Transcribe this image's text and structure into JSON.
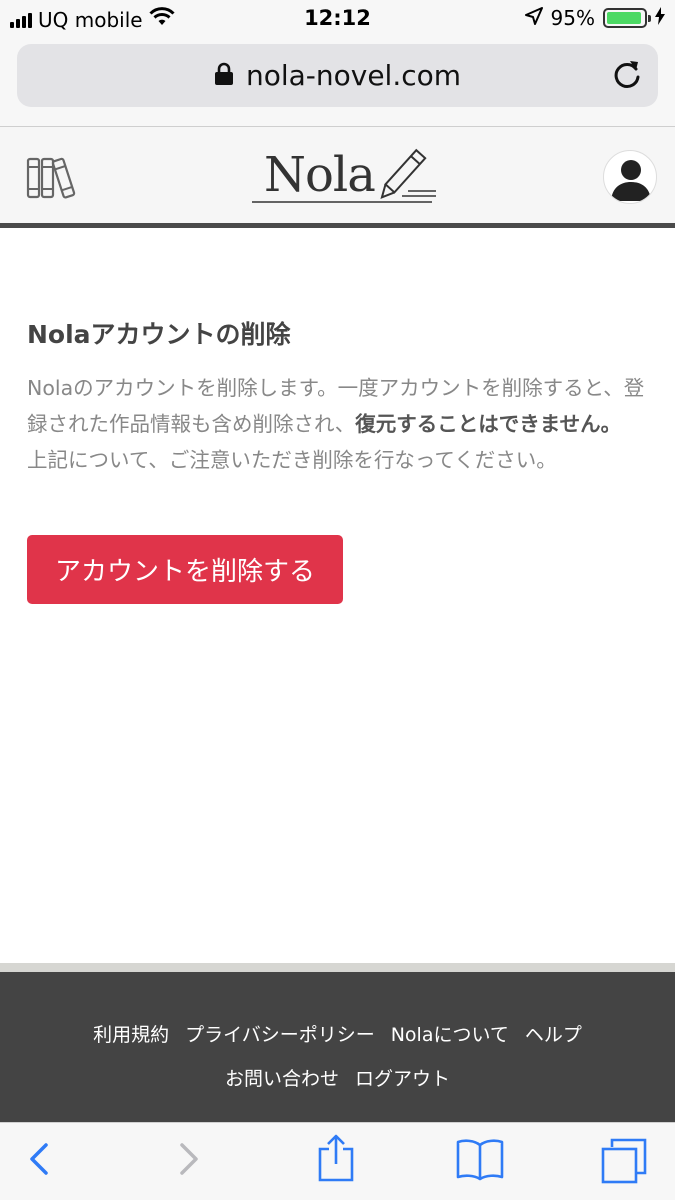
{
  "status_bar": {
    "carrier": "UQ mobile",
    "time": "12:12",
    "battery_percent": "95%",
    "battery_level": 0.95
  },
  "browser": {
    "url": "nola-novel.com"
  },
  "header": {
    "logo_text": "Nola"
  },
  "main": {
    "title": "Nolaアカウントの削除",
    "desc_part1": "Nolaのアカウントを削除します。一度アカウントを削除すると、登録された作品情報も含め削除され、",
    "desc_bold": "復元することはできません。",
    "desc_part2": "上記について、ご注意いただき削除を行なってください。",
    "delete_button": "アカウントを削除する"
  },
  "footer": {
    "links": [
      "利用規約",
      "プライバシーポリシー",
      "Nolaについて",
      "ヘルプ"
    ],
    "links_row2": [
      "お問い合わせ",
      "ログアウト"
    ]
  },
  "colors": {
    "accent_red": "#e0344a",
    "header_border": "#4a4a4a",
    "footer_bg": "#444444",
    "ios_blue": "#2f7bf6",
    "battery_green": "#4cd964"
  },
  "icons": [
    "wifi-icon",
    "location-icon",
    "lock-icon",
    "reload-icon",
    "books-icon",
    "pen-icon",
    "user-avatar-icon",
    "back-icon",
    "forward-icon",
    "share-icon",
    "bookmarks-icon",
    "tabs-icon"
  ]
}
